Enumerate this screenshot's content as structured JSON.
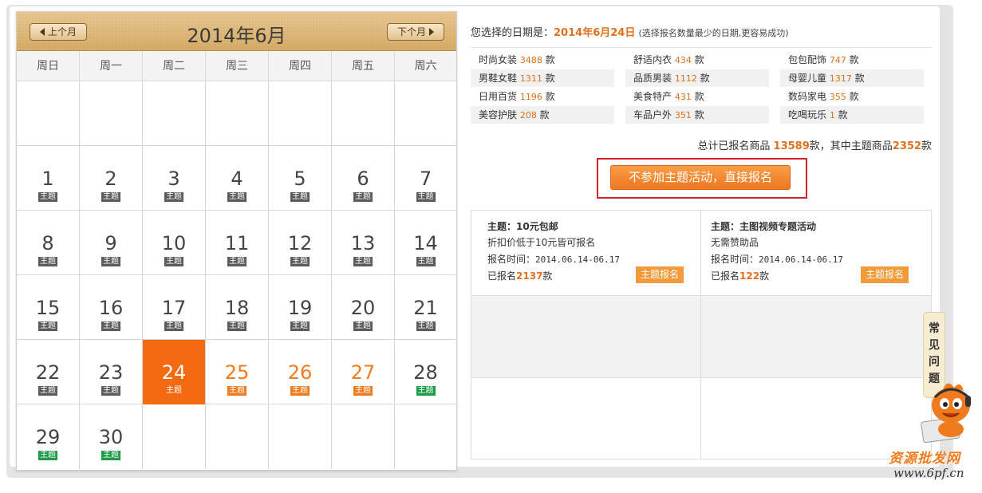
{
  "calendar": {
    "prev_label": "上个月",
    "next_label": "下个月",
    "title": "2014年6月",
    "weekdays": [
      "周日",
      "周一",
      "周二",
      "周三",
      "周四",
      "周五",
      "周六"
    ],
    "tag_label": "主题",
    "rows": [
      [
        null,
        null,
        null,
        null,
        null,
        null,
        null
      ],
      [
        "1",
        "2",
        "3",
        "4",
        "5",
        "6",
        "7"
      ],
      [
        "8",
        "9",
        "10",
        "11",
        "12",
        "13",
        "14"
      ],
      [
        "15",
        "16",
        "17",
        "18",
        "19",
        "20",
        "21"
      ],
      [
        "22",
        "23",
        "24",
        "25",
        "26",
        "27",
        "28"
      ],
      [
        "29",
        "30",
        null,
        null,
        null,
        null,
        null
      ]
    ],
    "selected": "24",
    "future_orange": [
      "25",
      "26",
      "27"
    ],
    "future_green": [
      "28",
      "29",
      "30"
    ]
  },
  "selection": {
    "prefix": "您选择的日期是：",
    "date": "2014年6月24日",
    "hint": "(选择报名数量最少的日期,更容易成功)"
  },
  "categories": [
    {
      "name": "时尚女装",
      "count": "3488",
      "unit": "款"
    },
    {
      "name": "舒适内衣",
      "count": "434",
      "unit": "款"
    },
    {
      "name": "包包配饰",
      "count": "747",
      "unit": "款"
    },
    {
      "name": "男鞋女鞋",
      "count": "1311",
      "unit": "款"
    },
    {
      "name": "品质男装",
      "count": "1112",
      "unit": "款"
    },
    {
      "name": "母婴儿童",
      "count": "1317",
      "unit": "款"
    },
    {
      "name": "日用百货",
      "count": "1196",
      "unit": "款"
    },
    {
      "name": "美食特产",
      "count": "431",
      "unit": "款"
    },
    {
      "name": "数码家电",
      "count": "355",
      "unit": "款"
    },
    {
      "name": "美容护肤",
      "count": "208",
      "unit": "款"
    },
    {
      "name": "车品户外",
      "count": "351",
      "unit": "款"
    },
    {
      "name": "吃喝玩乐",
      "count": "1",
      "unit": "款"
    }
  ],
  "total": {
    "prefix": "总计已报名商品 ",
    "count": "13589",
    "middle": "款，其中主题商品",
    "theme_count": "2352",
    "suffix": "款"
  },
  "direct_button": "不参加主题活动，直接报名",
  "themes": [
    {
      "title": "主题：10元包邮",
      "desc": "折扣价低于10元皆可报名",
      "time_label": "报名时间：",
      "time": "2014.06.14-06.17",
      "signed_prefix": "已报名",
      "signed_count": "2137",
      "signed_suffix": "款",
      "button": "主题报名"
    },
    {
      "title": "主题：主图视频专题活动",
      "desc": "无需赞助品",
      "time_label": "报名时间：",
      "time": "2014.06.14-06.17",
      "signed_prefix": "已报名",
      "signed_count": "122",
      "signed_suffix": "款",
      "button": "主题报名"
    }
  ],
  "faq": [
    "常",
    "见",
    "问",
    "题"
  ],
  "watermark": {
    "line1": "资源批发网",
    "line2": "www.6pf.cn"
  },
  "colors": {
    "accent": "#f07a1e",
    "selected": "#f36a10",
    "green_tag": "#1f9a48",
    "highlight_box": "#d42121"
  }
}
